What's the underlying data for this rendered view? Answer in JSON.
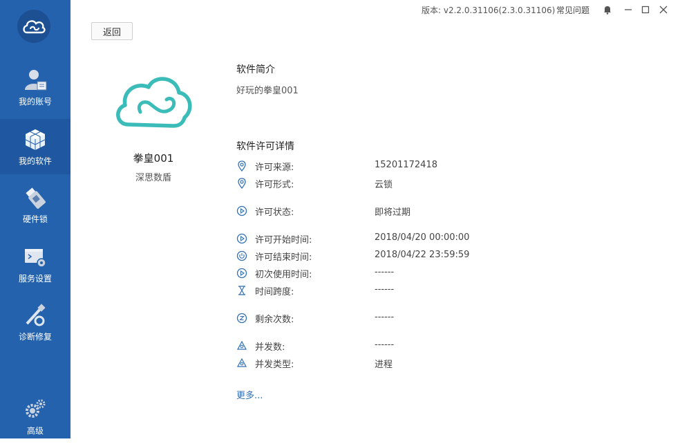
{
  "sidebar": {
    "items": [
      {
        "label": "我的账号",
        "icon": "account-icon"
      },
      {
        "label": "我的软件",
        "icon": "software-cube-icon"
      },
      {
        "label": "硬件锁",
        "icon": "usb-key-icon"
      },
      {
        "label": "服务设置",
        "icon": "service-settings-icon"
      },
      {
        "label": "诊断修复",
        "icon": "repair-tools-icon"
      }
    ],
    "advanced": {
      "label": "高级",
      "icon": "gears-icon"
    }
  },
  "topbar": {
    "version": "版本: v2.2.0.31106(2.3.0.31106)",
    "faq": "常见问题"
  },
  "back_label": "返回",
  "software": {
    "name": "拳皇001",
    "vendor": "深思数盾"
  },
  "intro": {
    "title": "软件简介",
    "text": "好玩的拳皇001"
  },
  "license": {
    "title": "软件许可详情",
    "rows": [
      {
        "key": "许可来源:",
        "value": "15201172418",
        "icon": "location-pin-icon"
      },
      {
        "key": "许可形式:",
        "value": "云锁",
        "icon": "location-pin-icon"
      },
      {
        "key": "许可状态:",
        "value": "即将过期",
        "icon": "play-circle-icon"
      },
      {
        "key": "许可开始时间:",
        "value": "2018/04/20 00:00:00",
        "icon": "play-circle-icon"
      },
      {
        "key": "许可结束时间:",
        "value": "2018/04/22 23:59:59",
        "icon": "power-icon"
      },
      {
        "key": "初次使用时间:",
        "value": "------",
        "icon": "play-circle-icon"
      },
      {
        "key": "时间跨度:",
        "value": "------",
        "icon": "hourglass-icon"
      },
      {
        "key": "剩余次数:",
        "value": "------",
        "icon": "counter-icon"
      },
      {
        "key": "并发数:",
        "value": "------",
        "icon": "network-icon"
      },
      {
        "key": "并发类型:",
        "value": "进程",
        "icon": "network-icon"
      }
    ],
    "more": "更多..."
  },
  "colors": {
    "sidebar": "#2462ad",
    "accent": "#2f6fb5",
    "logo_teal": "#3cbcb9"
  }
}
